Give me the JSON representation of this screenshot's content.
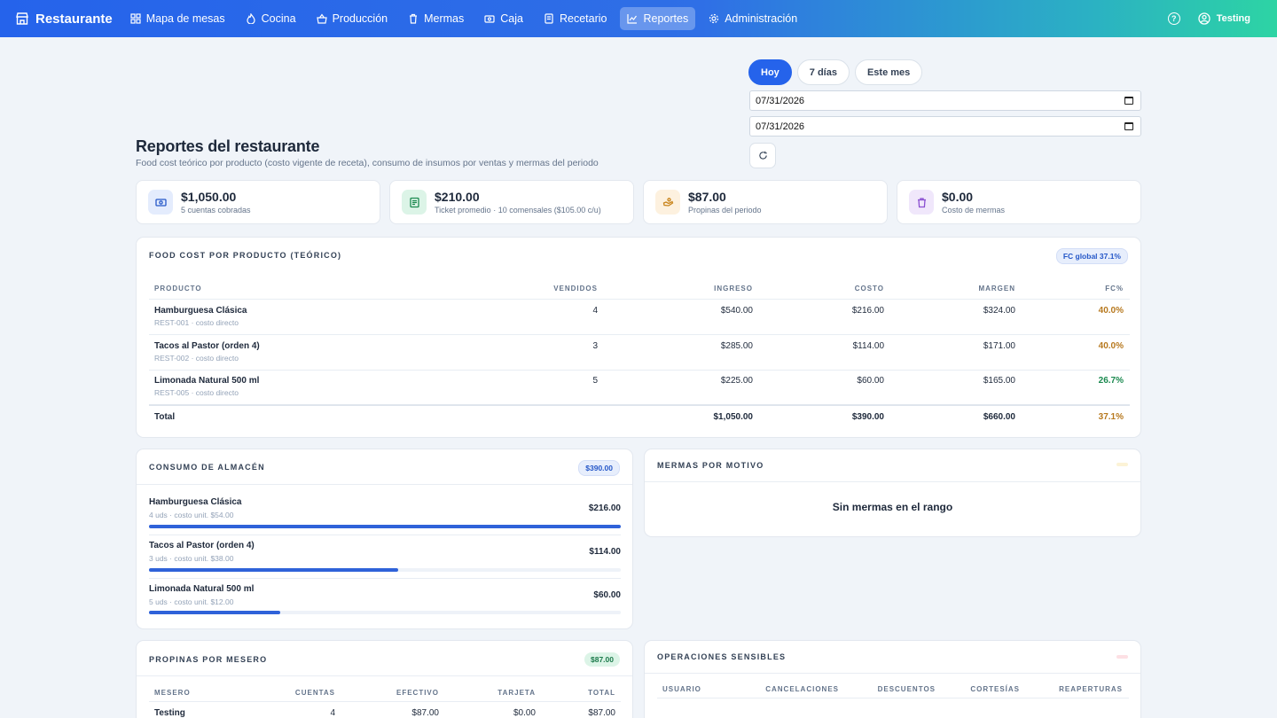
{
  "nav": {
    "brand": "Restaurante",
    "items": [
      {
        "label": "Mapa de mesas",
        "icon": "grid-icon"
      },
      {
        "label": "Cocina",
        "icon": "flame-icon"
      },
      {
        "label": "Producción",
        "icon": "basket-icon"
      },
      {
        "label": "Mermas",
        "icon": "trash-icon"
      },
      {
        "label": "Caja",
        "icon": "cash-register-icon"
      },
      {
        "label": "Recetario",
        "icon": "book-icon"
      },
      {
        "label": "Reportes",
        "icon": "chart-line-icon",
        "active": true
      },
      {
        "label": "Administración",
        "icon": "gear-icon"
      }
    ],
    "user": "Testing"
  },
  "header": {
    "title": "Reportes del restaurante",
    "subtitle": "Food cost teórico por producto (costo vigente de receta), consumo de insumos por ventas y mermas del periodo"
  },
  "range": {
    "buttons": [
      "Hoy",
      "7 días",
      "Este mes"
    ],
    "active": "Hoy",
    "from": "07/31/2026",
    "to": "07/31/2026"
  },
  "stats": [
    {
      "value": "$1,050.00",
      "label": "5 cuentas cobradas",
      "icon": "cash-icon",
      "bg": "#e4ecfd",
      "fg": "#2557c8"
    },
    {
      "value": "$210.00",
      "label": "Ticket promedio · 10 comensales ($105.00 c/u)",
      "icon": "receipt-icon",
      "bg": "#dcf4e7",
      "fg": "#1c8a50"
    },
    {
      "value": "$87.00",
      "label": "Propinas del periodo",
      "icon": "hand-coin-icon",
      "bg": "#fdf1df",
      "fg": "#c9851c"
    },
    {
      "value": "$0.00",
      "label": "Costo de mermas",
      "icon": "trash-icon",
      "bg": "#f0e7fb",
      "fg": "#8a4fd1"
    }
  ],
  "food_cost": {
    "title": "Food cost por producto (teórico)",
    "badge": "FC global 37.1%",
    "headers": [
      "Producto",
      "Vendidos",
      "Ingreso",
      "Costo",
      "Margen",
      "FC%"
    ],
    "rows": [
      {
        "name": "Hamburguesa Clásica",
        "sku": "REST-001 · costo directo",
        "sold": "4",
        "income": "$540.00",
        "cost": "$216.00",
        "margin": "$324.00",
        "fc": "40.0%",
        "fc_level": "amber"
      },
      {
        "name": "Tacos al Pastor (orden 4)",
        "sku": "REST-002 · costo directo",
        "sold": "3",
        "income": "$285.00",
        "cost": "$114.00",
        "margin": "$171.00",
        "fc": "40.0%",
        "fc_level": "amber"
      },
      {
        "name": "Limonada Natural 500 ml",
        "sku": "REST-005 · costo directo",
        "sold": "5",
        "income": "$225.00",
        "cost": "$60.00",
        "margin": "$165.00",
        "fc": "26.7%",
        "fc_level": "green"
      }
    ],
    "total": {
      "label": "Total",
      "income": "$1,050.00",
      "cost": "$390.00",
      "margin": "$660.00",
      "fc": "37.1%"
    }
  },
  "consumo": {
    "title": "Consumo de almacén",
    "badge": "$390.00",
    "items": [
      {
        "name": "Hamburguesa Clásica",
        "detail": "4 uds · costo unit. $54.00",
        "amount": "$216.00",
        "share": 1.0
      },
      {
        "name": "Tacos al Pastor (orden 4)",
        "detail": "3 uds · costo unit. $38.00",
        "amount": "$114.00",
        "share": 0.528
      },
      {
        "name": "Limonada Natural 500 ml",
        "detail": "5 uds · costo unit. $12.00",
        "amount": "$60.00",
        "share": 0.278
      }
    ]
  },
  "mermas": {
    "title": "Mermas por motivo",
    "empty": "Sin mermas en el rango"
  },
  "propinas": {
    "title": "Propinas por mesero",
    "badge": "$87.00",
    "headers": [
      "Mesero",
      "Cuentas",
      "Efectivo",
      "Tarjeta",
      "Total"
    ],
    "rows": [
      {
        "mesero": "Testing",
        "cuentas": "4",
        "efectivo": "$87.00",
        "tarjeta": "$0.00",
        "total": "$87.00"
      }
    ]
  },
  "operaciones": {
    "title": "Operaciones sensibles",
    "headers": [
      "Usuario",
      "Cancelaciones",
      "Descuentos",
      "Cortesías",
      "Reaperturas"
    ]
  }
}
